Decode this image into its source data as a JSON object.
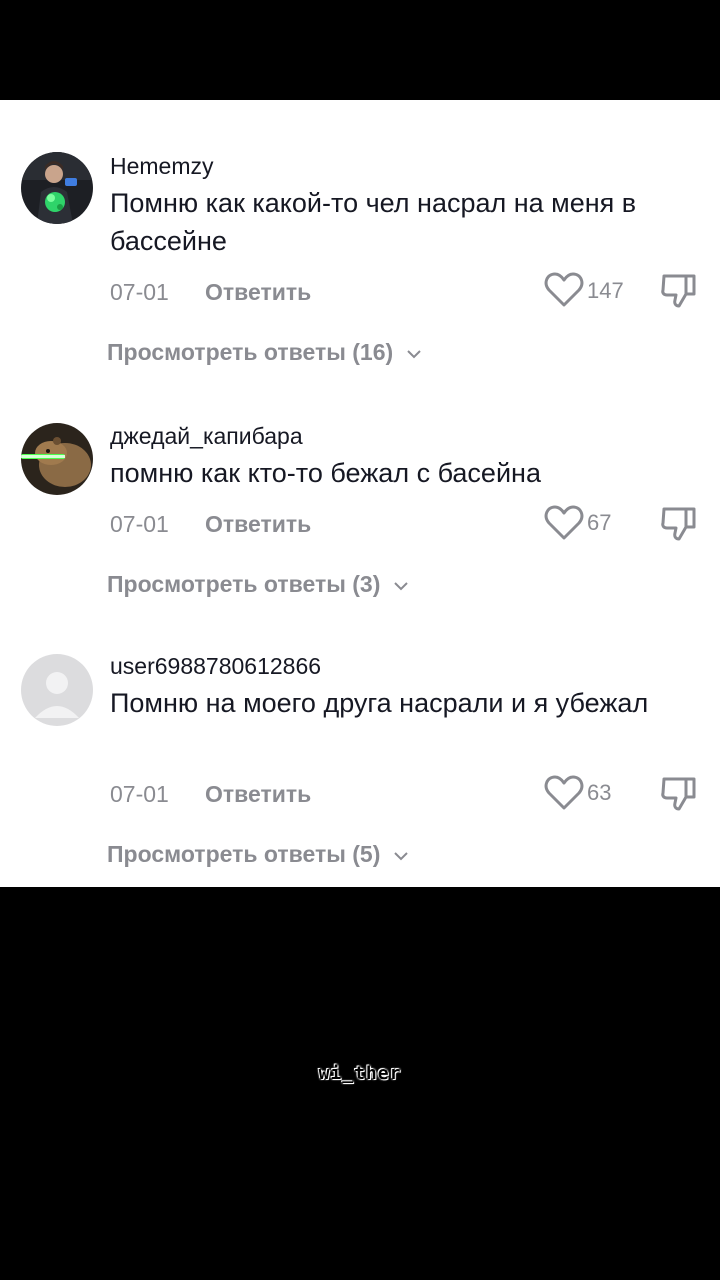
{
  "comments": [
    {
      "username": "Hememzy",
      "text": "Помню как какой-то чел насрал на меня в бассейне",
      "date": "07-01",
      "reply_label": "Ответить",
      "likes": "147",
      "view_replies": "Просмотреть ответы (16)",
      "avatar_icon": "user-photo-avatar"
    },
    {
      "username": "джедай_капибара",
      "text": "помню как кто-то бежал с басейна",
      "date": "07-01",
      "reply_label": "Ответить",
      "likes": "67",
      "view_replies": "Просмотреть ответы (3)",
      "avatar_icon": "capybara-avatar"
    },
    {
      "username": "user6988780612866",
      "text": "Помню на моего друга насрали и я убежал",
      "date": "07-01",
      "reply_label": "Ответить",
      "likes": "63",
      "view_replies": "Просмотреть ответы (5)",
      "avatar_icon": "default-user-avatar"
    }
  ],
  "watermark": "wi_ther",
  "colors": {
    "background": "#000000",
    "panel": "#ffffff",
    "primary_text": "#161823",
    "secondary_text": "#8a8b91"
  }
}
